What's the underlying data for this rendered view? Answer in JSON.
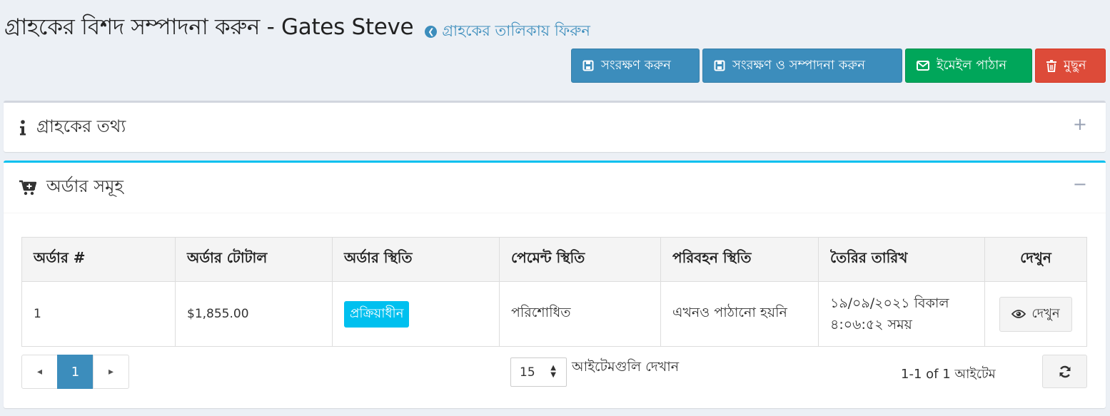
{
  "header": {
    "title": "গ্রাহকের বিশদ সম্পাদনা করুন - Gates Steve",
    "back_link": "গ্রাহকের তালিকায় ফিরুন"
  },
  "toolbar": {
    "save_label": "সংরক্ষণ করুন",
    "save_continue_label": "সংরক্ষণ ও সম্পাদনা করুন",
    "email_label": "ইমেইল পাঠান",
    "delete_label": "মুছুন"
  },
  "info_panel": {
    "title": "গ্রাহকের তথ্য",
    "toggle": "+"
  },
  "orders_panel": {
    "title": "অর্ডার সমূহ",
    "toggle": "−",
    "columns": [
      "অর্ডার #",
      "অর্ডার টোটাল",
      "অর্ডার স্থিতি",
      "পেমেন্ট স্থিতি",
      "পরিবহন স্থিতি",
      "তৈরির তারিখ",
      "দেখুন"
    ],
    "rows": [
      {
        "order_no": "1",
        "total": "$1,855.00",
        "order_status": "প্রক্রিয়াধীন",
        "payment_status": "পরিশোধিত",
        "shipping_status": "এখনও পাঠানো হয়নি",
        "created_line1": "১৯/০৯/২০২১ বিকাল",
        "created_line2": "৪:০৬:৫২ সময়",
        "view_label": "দেখুন"
      }
    ],
    "pager": {
      "prev": "◂",
      "current_page": "1",
      "next": "▸"
    },
    "page_size": {
      "value": "15",
      "label": "আইটেমগুলি দেখান"
    },
    "page_info": "1-1 of 1 আইটেম"
  },
  "colors": {
    "primary": "#3c8dbc",
    "success": "#00a65a",
    "danger": "#dd4b39",
    "info": "#00c0ef",
    "background": "#ecf0f5"
  },
  "icons": {
    "back": "circle-arrow-left-icon",
    "save": "floppy-icon",
    "email": "envelope-icon",
    "delete": "trash-icon",
    "info": "info-icon",
    "orders": "cart-plus-icon",
    "view": "eye-icon",
    "refresh": "refresh-icon"
  }
}
